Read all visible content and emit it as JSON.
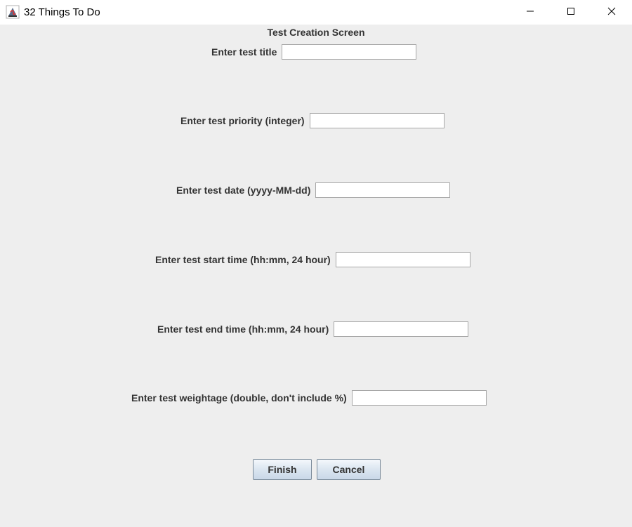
{
  "window": {
    "title": "32 Things To Do",
    "app_icon": "java-coffee-cup-icon",
    "controls": [
      "minimize-icon",
      "maximize-icon",
      "close-icon"
    ]
  },
  "form": {
    "heading": "Test Creation Screen",
    "fields": [
      {
        "label": "Enter test title",
        "value": ""
      },
      {
        "label": "Enter test priority (integer)",
        "value": ""
      },
      {
        "label": "Enter test date (yyyy-MM-dd)",
        "value": ""
      },
      {
        "label": "Enter test start time (hh:mm, 24 hour)",
        "value": ""
      },
      {
        "label": "Enter test end time (hh:mm, 24 hour)",
        "value": ""
      },
      {
        "label": "Enter test weightage (double, don't include %)",
        "value": ""
      }
    ]
  },
  "buttons": {
    "finish": "Finish",
    "cancel": "Cancel"
  }
}
